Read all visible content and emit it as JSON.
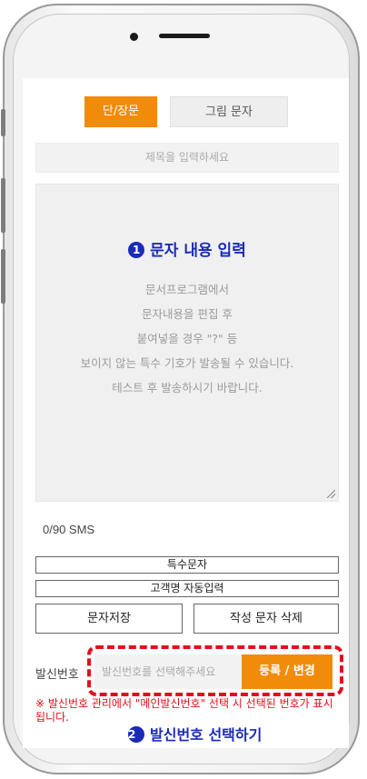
{
  "tabs": {
    "short_long": "단/장문",
    "image": "그림 문자"
  },
  "subject": {
    "placeholder": "제목을 입력하세요"
  },
  "guide1": {
    "number": "1",
    "text": "문자 내용 입력"
  },
  "message_placeholder_lines": [
    "문서프로그램에서",
    "문자내용을 편집 후",
    "붙여넣을 경우 \"?\" 등",
    "보이지 않는 특수 기호가 발송될 수 있습니다.",
    "테스트 후 발송하시기 바랍니다."
  ],
  "counter": "0/90 SMS",
  "buttons": {
    "special_chars": "특수문자",
    "auto_name": "고객명 자동입력",
    "save_message": "문자저장",
    "delete_message": "작성 문자 삭제",
    "register_change": "등록 / 변경"
  },
  "sender": {
    "label": "발신번호",
    "placeholder": "발신번호를 선택해주세요"
  },
  "note": "※ 발신번호 관리에서 \"메인발신번호\" 선택 시 선택된 번호가 표시됩니다.",
  "guide2": {
    "number": "2",
    "text": "발신번호 선택하기"
  },
  "colors": {
    "accent": "#f08c0a",
    "guide": "#1a2ab8",
    "highlight": "#e0101a"
  }
}
